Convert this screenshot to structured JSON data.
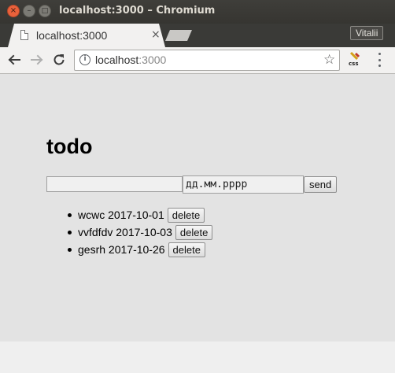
{
  "window": {
    "title": "localhost:3000 – Chromium",
    "close_glyph": "×",
    "min_glyph": "–",
    "max_glyph": "□"
  },
  "tab": {
    "title": "localhost:3000",
    "close_glyph": "×"
  },
  "profile": {
    "name": "Vitalii"
  },
  "toolbar": {
    "url_host": "localhost",
    "url_port": ":3000",
    "info_glyph": "i",
    "star_glyph": "☆",
    "extension_label": "css"
  },
  "app": {
    "title": "todo",
    "text_input_value": "",
    "date_placeholder": "дд.мм.рррр",
    "send_label": "send",
    "todos": [
      {
        "text": "wcwc",
        "date": "2017-10-01",
        "delete_label": "delete"
      },
      {
        "text": "vvfdfdv",
        "date": "2017-10-03",
        "delete_label": "delete"
      },
      {
        "text": "gesrh",
        "date": "2017-10-26",
        "delete_label": "delete"
      }
    ]
  },
  "colors": {
    "titlebar": "#3a3a37",
    "close_button": "#e9613b",
    "page_background": "#e3e3e3"
  }
}
